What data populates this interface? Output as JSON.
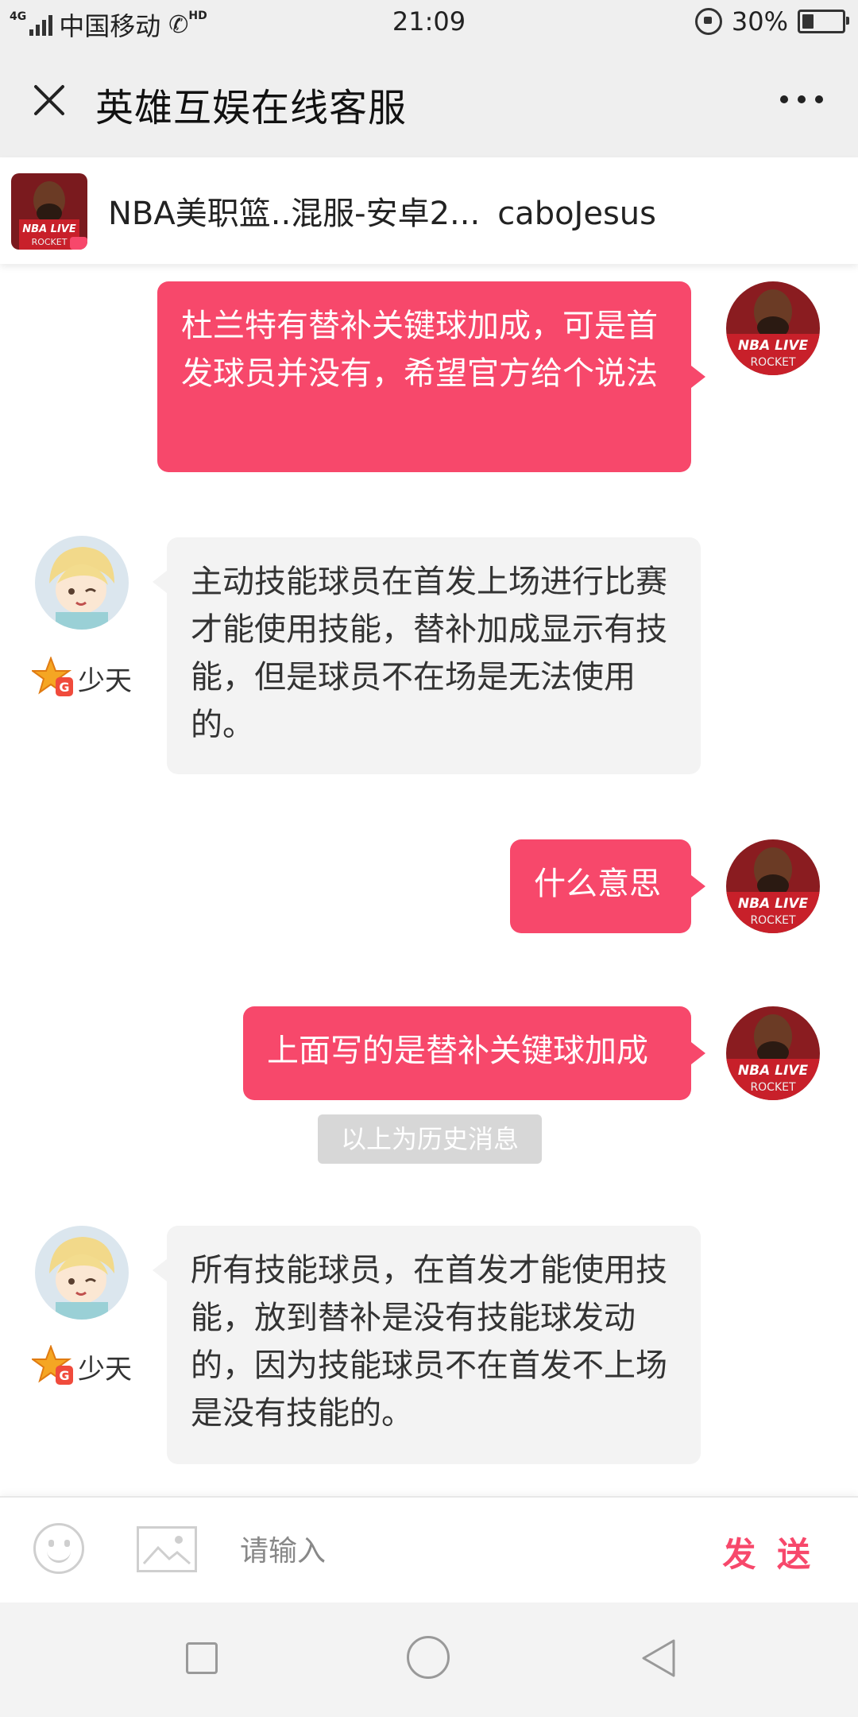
{
  "status_bar": {
    "network": "4G",
    "carrier": "中国移动",
    "hd": "HD",
    "time": "21:09",
    "battery": "30%",
    "battery_level": 0.3
  },
  "header": {
    "title": "英雄互娱在线客服"
  },
  "game_info": {
    "server": "NBA美职篮..混服-安卓2...",
    "player": "caboJesus"
  },
  "messages": [
    {
      "from": "user",
      "text": "杜兰特有替补关键球加成，可是首发球员并没有，希望官方给个说法"
    },
    {
      "from": "agent",
      "agent_name": "少天",
      "text": "主动技能球员在首发上场进行比赛才能使用技能，替补加成显示有技能，但是球员不在场是无法使用的。"
    },
    {
      "from": "user",
      "text": "什么意思"
    },
    {
      "from": "user",
      "text": "上面写的是替补关键球加成"
    },
    {
      "from": "agent",
      "agent_name": "少天",
      "text": "所有技能球员，在首发才能使用技能，放到替补是没有技能球发动的，因为技能球员不在首发不上场是没有技能的。"
    }
  ],
  "history_divider": "以上为历史消息",
  "composer": {
    "placeholder": "请输入",
    "send_label": "发 送"
  },
  "colors": {
    "accent": "#f7486b",
    "header_bg": "#efefef",
    "agent_bubble": "#f3f3f3"
  },
  "icons": {
    "close": "close-icon",
    "more": "more-icon",
    "emoji": "emoji-icon",
    "image": "image-icon",
    "nav_recent": "square-icon",
    "nav_home": "circle-icon",
    "nav_back": "triangle-back-icon"
  }
}
